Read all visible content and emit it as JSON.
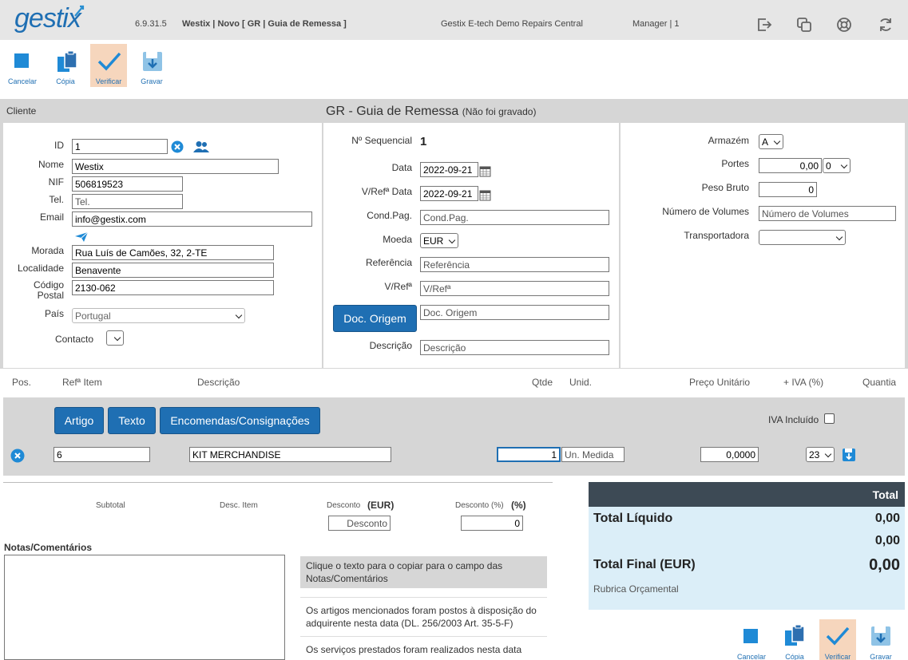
{
  "header": {
    "logo": "gestix",
    "version": "6.9.31.5",
    "doc_title": "Westix | Novo [ GR | Guia de Remessa ]",
    "company": "Gestix E-tech Demo Repairs Central",
    "user": "Manager | 1"
  },
  "toolbar": {
    "cancel": "Cancelar",
    "copy": "Cópia",
    "verify": "Verificar",
    "save": "Gravar"
  },
  "section": {
    "client": "Cliente",
    "title": "GR - Guia de Remessa",
    "title_note": "(Não foi gravado)"
  },
  "client": {
    "id_label": "ID",
    "id_value": "1",
    "name_label": "Nome",
    "name_value": "Westix",
    "nif_label": "NIF",
    "nif_value": "506819523",
    "tel_label": "Tel.",
    "tel_placeholder": "Tel.",
    "email_label": "Email",
    "email_value": "info@gestix.com",
    "address_label": "Morada",
    "address_value": "Rua Luís de Camões, 32, 2-TE",
    "city_label": "Localidade",
    "city_value": "Benavente",
    "postal_label_1": "Código",
    "postal_label_2": "Postal",
    "postal_value": "2130-062",
    "country_label": "País",
    "country_value": "Portugal",
    "contact_label": "Contacto"
  },
  "doc": {
    "seq_label": "Nº Sequencial",
    "seq_value": "1",
    "date_label": "Data",
    "date_value": "2022-09-21",
    "vref_date_label": "V/Refª Data",
    "vref_date_value": "2022-09-21",
    "cond_label": "Cond.Pag.",
    "cond_placeholder": "Cond.Pag.",
    "currency_label": "Moeda",
    "currency_value": "EUR",
    "ref_label": "Referência",
    "ref_placeholder": "Referência",
    "vref_label": "V/Refª",
    "vref_placeholder": "V/Refª",
    "origin_button": "Doc. Origem",
    "origin_placeholder": "Doc. Origem",
    "desc_label": "Descrição",
    "desc_placeholder": "Descrição"
  },
  "shipping": {
    "warehouse_label": "Armazém",
    "warehouse_value": "A",
    "freight_label": "Portes",
    "freight_value": "0,00",
    "freight_tax": "0",
    "weight_label": "Peso Bruto",
    "weight_value": "0",
    "volumes_label": "Número de Volumes",
    "volumes_placeholder": "Número de Volumes",
    "carrier_label": "Transportadora",
    "carrier_value": ""
  },
  "lines": {
    "headers": {
      "pos": "Pos.",
      "ref": "Refª Item",
      "desc": "Descrição",
      "qty": "Qtde",
      "unit": "Unid.",
      "price": "Preço Unitário",
      "vat": "+ IVA (%)",
      "amount": "Quantia"
    },
    "buttons": {
      "article": "Artigo",
      "text": "Texto",
      "orders": "Encomendas/Consignações"
    },
    "vat_included_label": "IVA Incluído",
    "row": {
      "ref": "6",
      "desc": "KIT MERCHANDISE",
      "qty": "1",
      "unit_placeholder": "Un. Medida",
      "price": "0,0000",
      "vat": "23"
    }
  },
  "summary": {
    "subtotal": "Subtotal",
    "item_discount": "Desc. Item",
    "discount": "Desconto",
    "discount_unit": "(EUR)",
    "discount_placeholder": "Desconto",
    "discount_pct": "Desconto (%)",
    "pct_unit": "(%)",
    "pct_value": "0"
  },
  "notes": {
    "label": "Notas/Comentários",
    "hint": "Clique o texto para o copiar para o campo das Notas/Comentários",
    "items": [
      "Os artigos mencionados foram postos à disposição do adquirente nesta data (DL. 256/2003 Art. 35-5-F)",
      "Os serviços prestados foram realizados nesta data"
    ]
  },
  "totals": {
    "header": "Total",
    "net_label": "Total Líquido",
    "net_value": "0,00",
    "second_value": "0,00",
    "final_label": "Total Final (EUR)",
    "final_value": "0,00",
    "budget_label": "Rubrica Orçamental"
  },
  "colors": {
    "accent": "#1f6fb3",
    "verify_bg": "#f6d6bd",
    "totals_dark": "#3d4a55",
    "totals_light": "#dbeef8",
    "panel_gray": "#d6d6d6"
  }
}
